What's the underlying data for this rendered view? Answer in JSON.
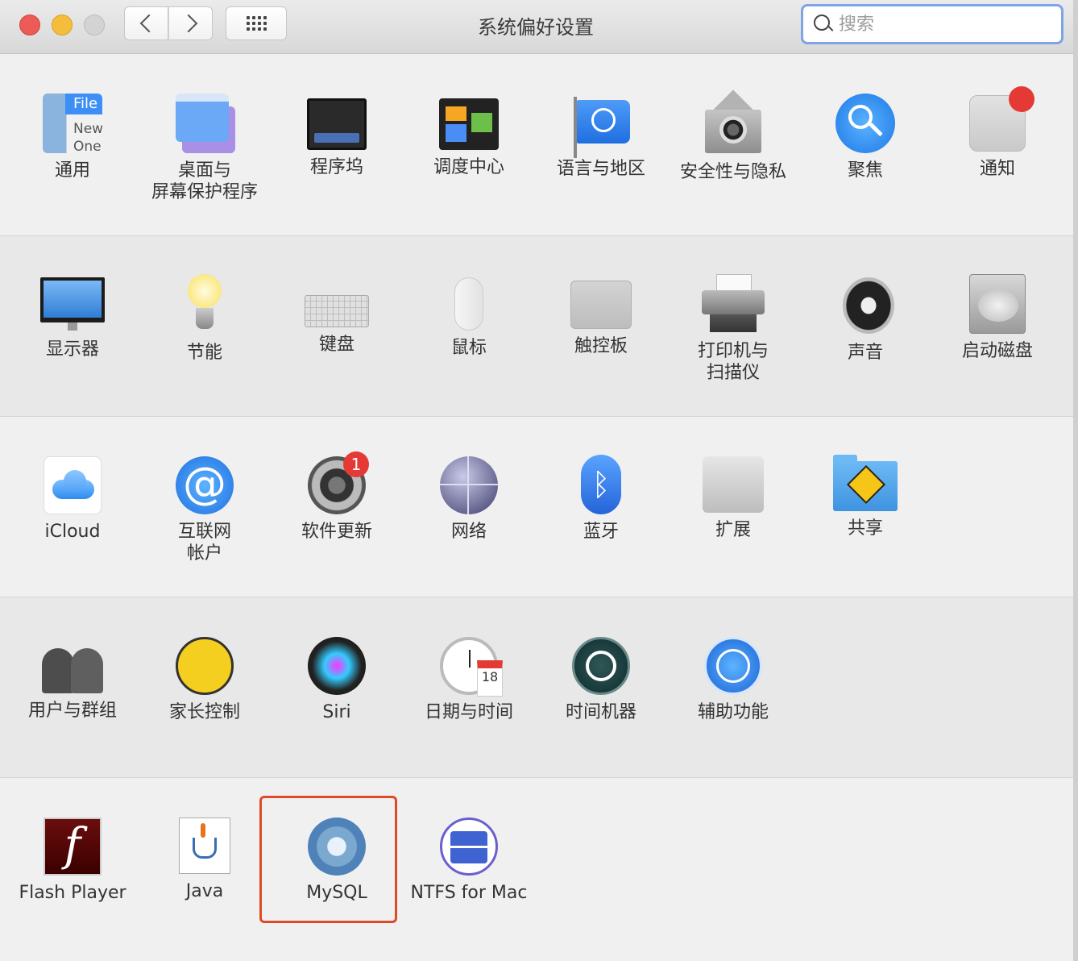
{
  "window": {
    "title": "系统偏好设置",
    "search_placeholder": "搜索"
  },
  "rows": [
    [
      {
        "label": "通用",
        "icon": "general-icon"
      },
      {
        "label": "桌面与\n屏幕保护程序",
        "icon": "desktop-screensaver-icon"
      },
      {
        "label": "程序坞",
        "icon": "dock-icon"
      },
      {
        "label": "调度中心",
        "icon": "mission-control-icon"
      },
      {
        "label": "语言与地区",
        "icon": "language-region-icon"
      },
      {
        "label": "安全性与隐私",
        "icon": "security-privacy-icon"
      },
      {
        "label": "聚焦",
        "icon": "spotlight-icon"
      },
      {
        "label": "通知",
        "icon": "notifications-icon"
      }
    ],
    [
      {
        "label": "显示器",
        "icon": "display-icon"
      },
      {
        "label": "节能",
        "icon": "energy-saver-icon"
      },
      {
        "label": "键盘",
        "icon": "keyboard-icon"
      },
      {
        "label": "鼠标",
        "icon": "mouse-icon"
      },
      {
        "label": "触控板",
        "icon": "trackpad-icon"
      },
      {
        "label": "打印机与\n扫描仪",
        "icon": "printer-icon"
      },
      {
        "label": "声音",
        "icon": "sound-icon"
      },
      {
        "label": "启动磁盘",
        "icon": "startup-disk-icon"
      }
    ],
    [
      {
        "label": "iCloud",
        "icon": "icloud-icon"
      },
      {
        "label": "互联网\n帐户",
        "icon": "internet-accounts-icon"
      },
      {
        "label": "软件更新",
        "icon": "software-update-icon",
        "badge": "1"
      },
      {
        "label": "网络",
        "icon": "network-icon"
      },
      {
        "label": "蓝牙",
        "icon": "bluetooth-icon"
      },
      {
        "label": "扩展",
        "icon": "extensions-icon"
      },
      {
        "label": "共享",
        "icon": "sharing-icon"
      }
    ],
    [
      {
        "label": "用户与群组",
        "icon": "users-groups-icon"
      },
      {
        "label": "家长控制",
        "icon": "parental-controls-icon"
      },
      {
        "label": "Siri",
        "icon": "siri-icon"
      },
      {
        "label": "日期与时间",
        "icon": "date-time-icon",
        "calendar": "18"
      },
      {
        "label": "时间机器",
        "icon": "time-machine-icon"
      },
      {
        "label": "辅助功能",
        "icon": "accessibility-icon"
      }
    ],
    [
      {
        "label": "Flash Player",
        "icon": "flash-player-icon",
        "glyph": "f"
      },
      {
        "label": "Java",
        "icon": "java-icon"
      },
      {
        "label": "MySQL",
        "icon": "mysql-icon"
      },
      {
        "label": "NTFS for Mac",
        "icon": "ntfs-icon"
      }
    ]
  ],
  "highlighted_item": "MySQL"
}
